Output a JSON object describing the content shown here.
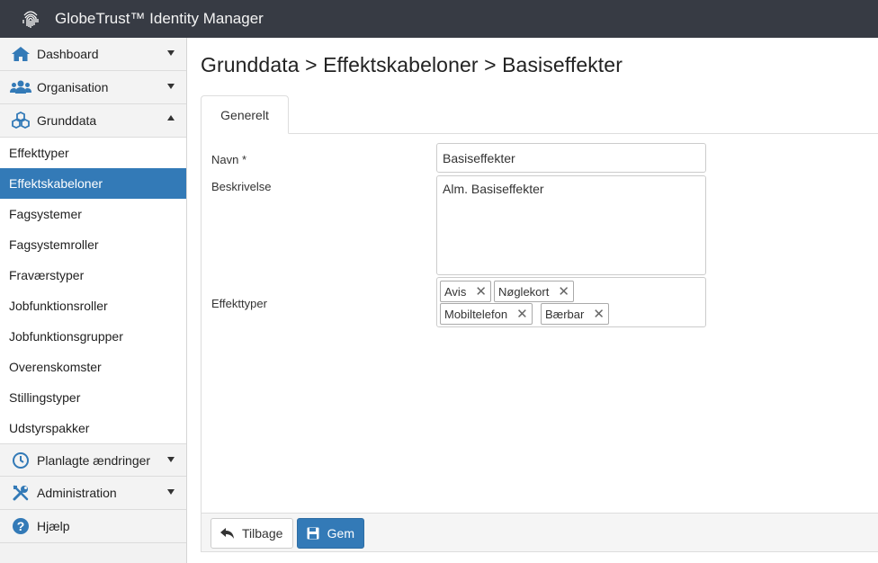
{
  "app": {
    "title": "GlobeTrust™ Identity Manager"
  },
  "sidebar": {
    "sections": [
      {
        "label": "Dashboard",
        "icon": "home-icon"
      },
      {
        "label": "Organisation",
        "icon": "users-icon"
      },
      {
        "label": "Grunddata",
        "icon": "cubes-icon"
      }
    ],
    "grunddata_items": [
      "Effekttyper",
      "Effektskabeloner",
      "Fagsystemer",
      "Fagsystemroller",
      "Fraværstyper",
      "Jobfunktionsroller",
      "Jobfunktionsgrupper",
      "Overenskomster",
      "Stillingstyper",
      "Udstyrspakker"
    ],
    "active_item": "Effektskabeloner",
    "bottom_sections": [
      {
        "label": "Planlagte ændringer",
        "icon": "clock-icon"
      },
      {
        "label": "Administration",
        "icon": "wrench-icon"
      },
      {
        "label": "Hjælp",
        "icon": "question-icon"
      }
    ]
  },
  "main": {
    "breadcrumb": "Grunddata > Effektskabeloner > Basiseffekter",
    "tab": "Generelt",
    "form": {
      "navn_label": "Navn *",
      "navn_value": "Basiseffekter",
      "beskrivelse_label": "Beskrivelse",
      "beskrivelse_value": "Alm. Basiseffekter",
      "effekttyper_label": "Effekttyper",
      "effekttyper_tags": [
        "Avis",
        "Nøglekort",
        "Mobiltelefon",
        "Bærbar"
      ]
    },
    "buttons": {
      "back": "Tilbage",
      "save": "Gem"
    }
  },
  "colors": {
    "topbar": "#373b44",
    "accent": "#337ab7",
    "sidebar_bg": "#f2f2f2"
  }
}
